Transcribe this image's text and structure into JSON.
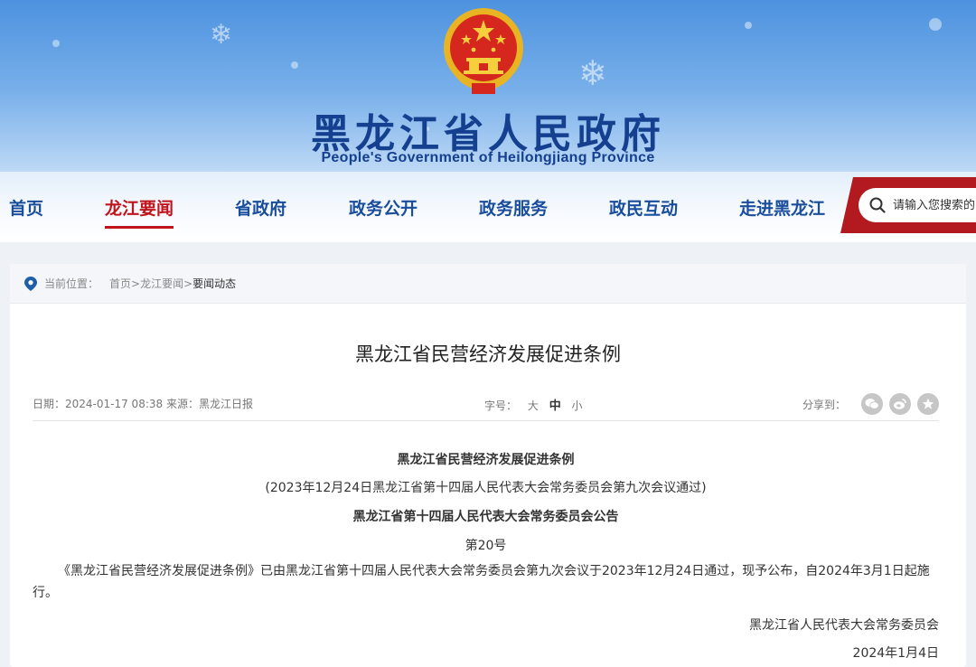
{
  "header": {
    "title": "黑龙江省人民政府",
    "subtitle": "People's Government of Heilongjiang Province"
  },
  "nav": {
    "items": [
      {
        "label": "首页"
      },
      {
        "label": "龙江要闻",
        "active": true
      },
      {
        "label": "省政府"
      },
      {
        "label": "政务公开"
      },
      {
        "label": "政务服务"
      },
      {
        "label": "政民互动"
      },
      {
        "label": "走进黑龙江"
      }
    ]
  },
  "search": {
    "placeholder": "请输入您搜索的内容"
  },
  "breadcrumb": {
    "label": "当前位置：",
    "items": [
      "首页",
      "龙江要闻",
      "要闻动态"
    ],
    "separator": ">"
  },
  "article": {
    "title": "黑龙江省民营经济发展促进条例",
    "meta": {
      "date_source": "日期：2024-01-17 08:38 来源：黑龙江日报",
      "font_label": "字号：",
      "font_sizes": [
        "大",
        "中",
        "小"
      ],
      "share_label": "分享到："
    },
    "body": {
      "heading": "黑龙江省民营经济发展促进条例",
      "passed_note": "(2023年12月24日黑龙江省第十四届人民代表大会常务委员会第九次会议通过)",
      "announcement_title": "黑龙江省第十四届人民代表大会常务委员会公告",
      "number": "第20号",
      "paragraph": "《黑龙江省民营经济发展促进条例》已由黑龙江省第十四届人民代表大会常务委员会第九次会议于2023年12月24日通过，现予公布，自2024年3月1日起施行。",
      "signature": "黑龙江省人民代表大会常务委员会",
      "date": "2024年1月4日"
    }
  },
  "colors": {
    "brand_blue": "#1a4d9c",
    "brand_red": "#c0141c",
    "search_red": "#b31a1f"
  },
  "icons": {
    "location": "location-pin-icon",
    "search": "search-icon",
    "share": [
      "wechat-icon",
      "weibo-icon",
      "favorite-star-icon"
    ],
    "emblem": "national-emblem"
  }
}
